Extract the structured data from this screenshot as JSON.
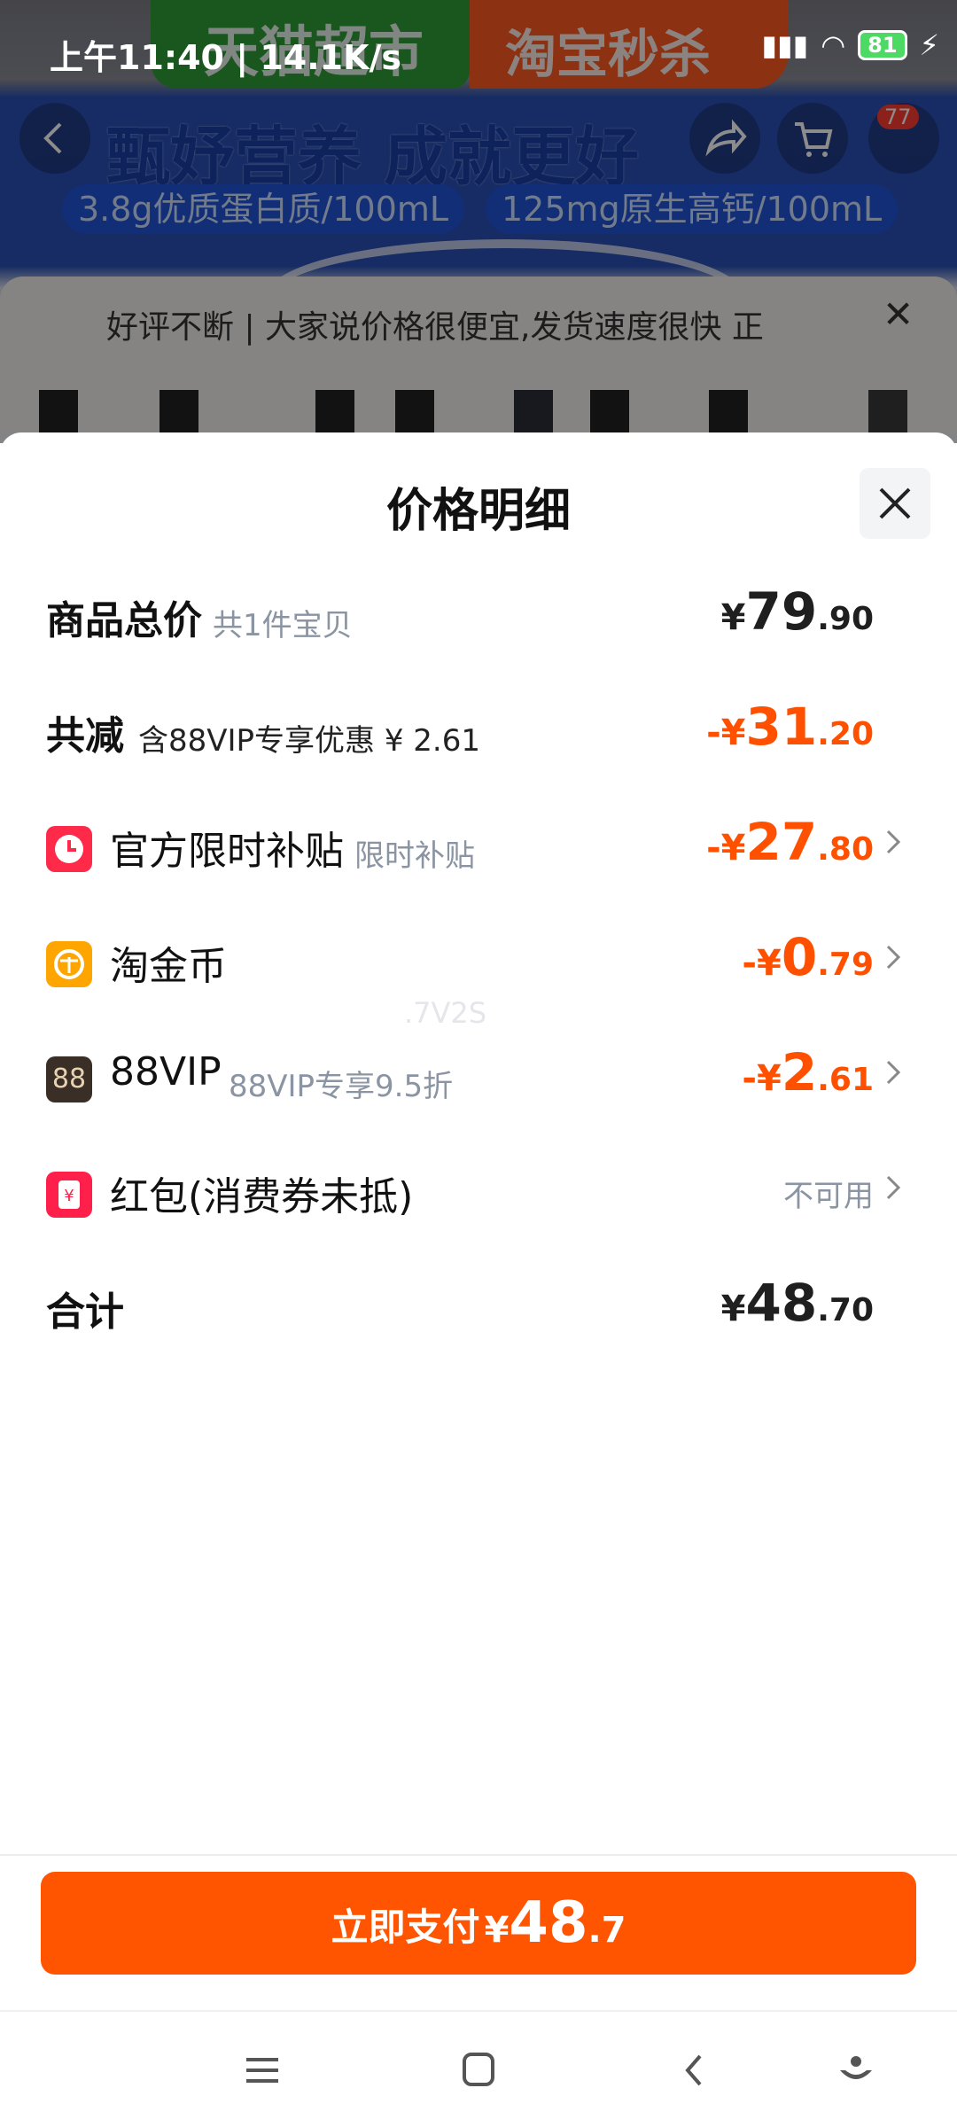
{
  "status_bar": {
    "time": "上午11:40",
    "speed": "14.1K/s",
    "battery": "81"
  },
  "background": {
    "banner_store": "天猫超市",
    "banner_flash": "淘宝秒杀",
    "headline": "甄妤营养 成就更好",
    "pill_left": "3.8g优质蛋白质/100mL",
    "pill_right": "125mg原生高钙/100mL",
    "cart_count": "77",
    "review_text": "好评不断 | 大家说价格很便宜,发货速度很快 正"
  },
  "sheet": {
    "title": "价格明细",
    "rows": [
      {
        "label": "商品总价",
        "sub": "共1件宝贝",
        "cur": "¥",
        "int": "79",
        "dec": ".90"
      },
      {
        "label": "共减",
        "sub": "含88VIP专享优惠 ¥ 2.61",
        "cur": "-¥",
        "int": "31",
        "dec": ".20"
      },
      {
        "label": "官方限时补贴",
        "sub": "限时补贴",
        "cur": "-¥",
        "int": "27",
        "dec": ".80",
        "icon": "clock-icon"
      },
      {
        "label": "淘金币",
        "cur": "-¥",
        "int": "0",
        "dec": ".79",
        "icon": "coin-icon"
      },
      {
        "label": "88VIP",
        "sub": "88VIP专享9.5折",
        "cur": "-¥",
        "int": "2",
        "dec": ".61",
        "icon": "vip-88-icon",
        "icon_text": "88"
      },
      {
        "label": "红包(消费券未抵)",
        "value": "不可用",
        "icon": "red-packet-icon"
      },
      {
        "label": "合计",
        "cur": "¥",
        "int": "48",
        "dec": ".70"
      }
    ],
    "watermark": ".7V2S"
  },
  "pay_button": {
    "label": "立即支付",
    "yen": "¥",
    "int": "48",
    "dec": ".7"
  },
  "colors": {
    "accent": "#ff5500",
    "discount": "#ff5000",
    "muted": "#8b94a3"
  }
}
